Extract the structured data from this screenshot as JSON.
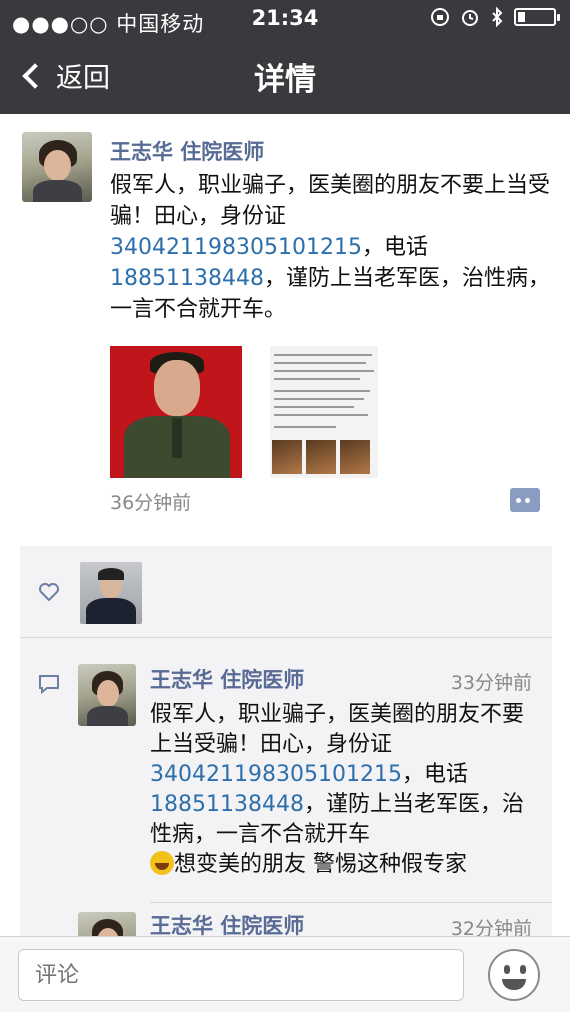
{
  "status_bar": {
    "signal": "●●●○○ 中国移动",
    "time": "21:34",
    "battery_level": 0.2
  },
  "nav": {
    "back_label": "返回",
    "title": "详情"
  },
  "post": {
    "author": "王志华 住院医师",
    "text_parts": {
      "p1": "假军人，职业骗子，医美圈的朋友不要上当受骗！田心，身份证",
      "id_number": "340421198305101215",
      "p2": "，电话",
      "phone": "18851138448",
      "p3": "，谨防上当老军医，治性病，一言不合就开车。"
    },
    "time": "36分钟前"
  },
  "comments": [
    {
      "author": "王志华 住院医师",
      "time": "33分钟前",
      "text_parts": {
        "p1": "假军人，职业骗子，医美圈的朋友不要上当受骗！田心，身份证",
        "id_number": "340421198305101215",
        "p2": "，电话",
        "phone": "18851138448",
        "p3": "，谨防上当老军医，治性病，一言不合就开车",
        "emoji": "laughing-emoji",
        "p4": "想变美的朋友 警惕这种假专家"
      }
    },
    {
      "author": "王志华 住院医师",
      "time": "32分钟前"
    }
  ],
  "bottom": {
    "input_placeholder": "评论"
  },
  "colors": {
    "nav_bg": "#3a3a3e",
    "name_color": "#586b95",
    "link_color": "#2d6fab",
    "panel_bg": "#f3f3f5"
  }
}
